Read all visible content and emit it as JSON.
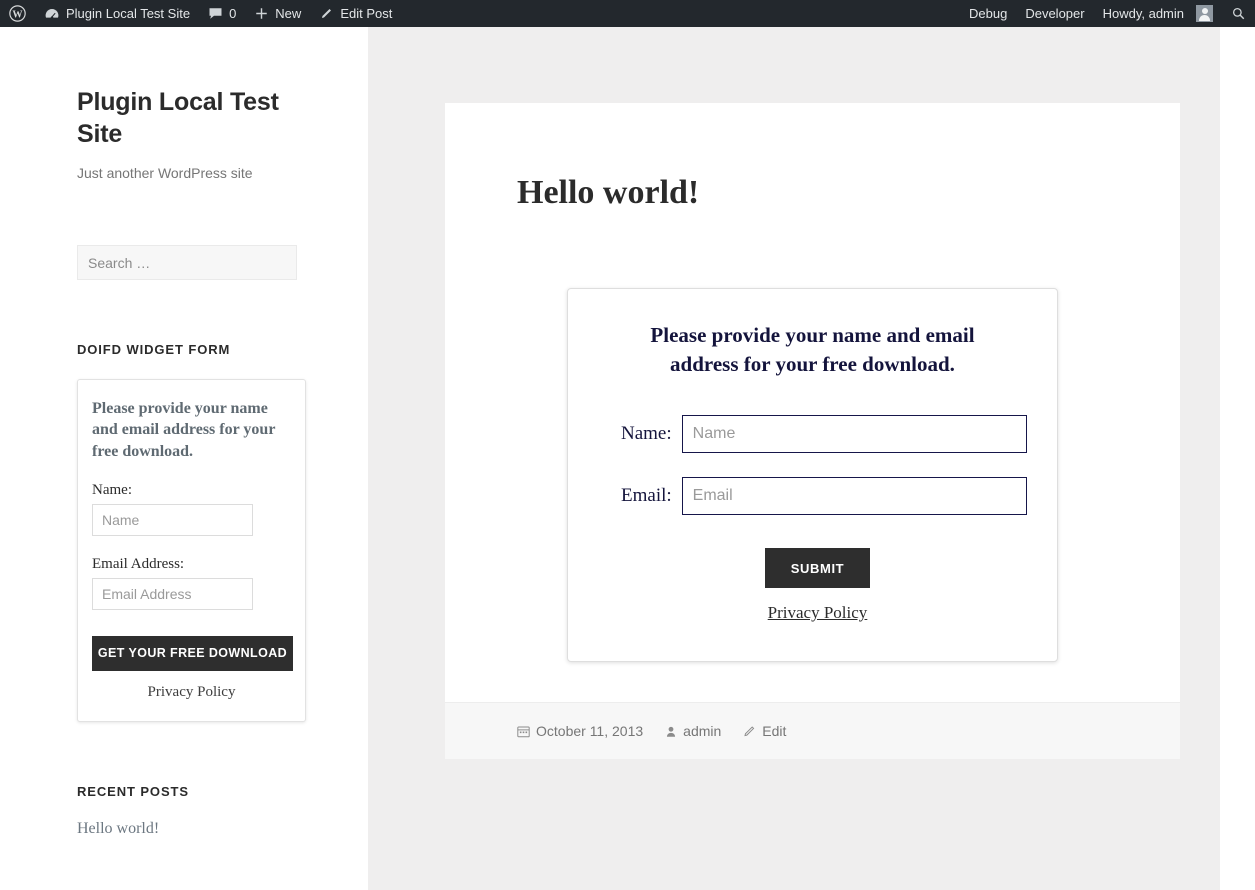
{
  "admin_bar": {
    "left_items": [
      {
        "icon": "wordpress-logo-icon",
        "label": ""
      },
      {
        "icon": "dashboard-speedometer-icon",
        "label": "Plugin Local Test Site"
      },
      {
        "icon": "comment-bubble-icon",
        "label": "0"
      },
      {
        "icon": "plus-icon",
        "label": "New"
      },
      {
        "icon": "pencil-icon",
        "label": "Edit Post"
      }
    ],
    "right_items": [
      {
        "label": "Debug"
      },
      {
        "label": "Developer"
      },
      {
        "label": "Howdy, admin"
      }
    ],
    "avatar_name": "avatar",
    "search_icon": "search-icon",
    "background_color": "#23282d"
  },
  "sidebar": {
    "site_title": "Plugin Local Test Site",
    "site_description": "Just another WordPress site",
    "search": {
      "placeholder": "Search …",
      "value": ""
    },
    "widget_form": {
      "title": "DOIFD WIDGET FORM",
      "intro": "Please provide your name and email address for your free download.",
      "name_label": "Name:",
      "name_placeholder": "Name",
      "name_value": "",
      "email_label": "Email Address:",
      "email_placeholder": "Email Address",
      "email_value": "",
      "submit_label": "GET YOUR FREE DOWNLOAD",
      "privacy_label": "Privacy Policy"
    },
    "recent_posts": {
      "title": "RECENT POSTS",
      "items": [
        {
          "label": "Hello world!"
        }
      ]
    }
  },
  "post": {
    "title": "Hello world!",
    "form": {
      "intro": "Please provide your name and email address for your free download.",
      "name_label": "Name:",
      "name_placeholder": "Name",
      "name_value": "",
      "email_label": "Email:",
      "email_placeholder": "Email",
      "email_value": "",
      "submit_label": "SUBMIT",
      "privacy_label": "Privacy Policy",
      "input_border_color": "#16164a"
    },
    "meta": {
      "date": "October 11, 2013",
      "author": "admin",
      "edit_label": "Edit",
      "date_icon": "calendar-icon",
      "author_icon": "user-icon",
      "edit_icon": "pencil-icon"
    }
  },
  "theme": {
    "page_background": "#efeeee",
    "card_background": "#ffffff",
    "button_color": "#2e2e2e",
    "muted_text": "#767676"
  }
}
